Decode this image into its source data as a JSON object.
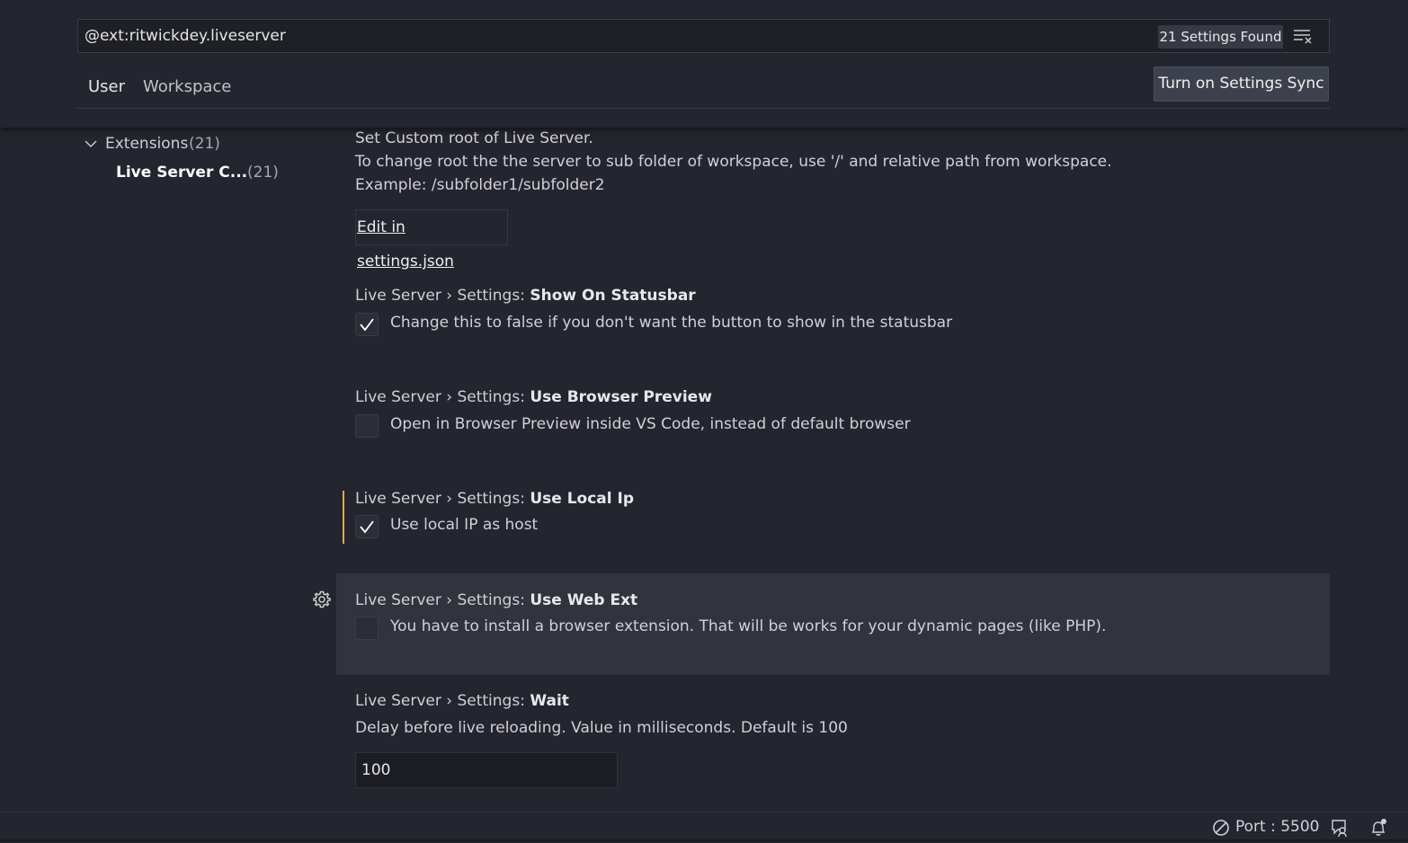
{
  "search": {
    "value": "@ext:ritwickdey.liveserver",
    "results_count": "21 Settings Found"
  },
  "tabs": [
    {
      "label": "User",
      "active": true
    },
    {
      "label": "Workspace",
      "active": false
    }
  ],
  "sync_button_label": "Turn on Settings Sync",
  "toc": {
    "group_label": "Extensions",
    "group_count": "(21)",
    "item_label": "Live Server C...",
    "item_count": "(21)"
  },
  "root_setting": {
    "description_lines": [
      "Set Custom root of Live Server.",
      "To change root the the server to sub folder of workspace, use '/' and relative path from workspace.",
      "Example: /subfolder1/subfolder2"
    ],
    "edit_link": "Edit in settings.json"
  },
  "settings": [
    {
      "category": "Live Server › Settings: ",
      "name": "Show On Statusbar",
      "checked": true,
      "description": "Change this to false if you don't want the button to show in the statusbar"
    },
    {
      "category": "Live Server › Settings: ",
      "name": "Use Browser Preview",
      "checked": false,
      "description": "Open in Browser Preview inside VS Code, instead of default browser"
    },
    {
      "category": "Live Server › Settings: ",
      "name": "Use Local Ip",
      "checked": true,
      "modified": true,
      "description": "Use local IP as host"
    },
    {
      "category": "Live Server › Settings: ",
      "name": "Use Web Ext",
      "checked": false,
      "focused": true,
      "description": "You have to install a browser extension. That will be works for your dynamic pages (like PHP)."
    },
    {
      "category": "Live Server › Settings: ",
      "name": "Wait",
      "description": "Delay before live reloading. Value in milliseconds. Default is 100",
      "value": "100"
    }
  ],
  "statusbar": {
    "port_label": "Port : 5500"
  },
  "icons": {
    "clear_filter": "clear-filter-icon",
    "chevron": "chevron-down-icon",
    "check": "check-icon",
    "gear": "gear-icon",
    "port": "circle-slash-icon",
    "feedback": "feedback-icon",
    "bell": "bell-icon"
  },
  "colors": {
    "background": "#23262e",
    "modified_indicator": "#e5a94b",
    "focused_row": "#31343d"
  }
}
